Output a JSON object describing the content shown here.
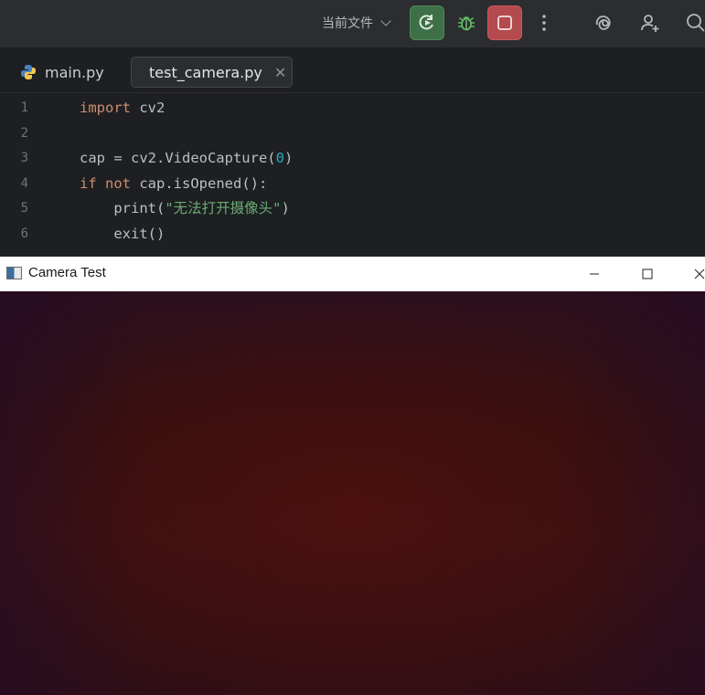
{
  "toolbar": {
    "run_config_label": "当前文件",
    "rerun_icon": "rerun-icon",
    "debug_icon": "bug-icon",
    "stop_icon": "stop-icon",
    "more_icon": "more-vertical-icon",
    "ai_icon": "ai-assistant-icon",
    "user_icon": "add-user-icon",
    "search_icon": "search-icon",
    "colors": {
      "rerun_bg": "#3d7046",
      "stop_bg": "#b34a4e",
      "debug_green": "#5fb865"
    }
  },
  "tabs": [
    {
      "label": "main.py",
      "icon": "python-icon",
      "active": false
    },
    {
      "label": "test_camera.py",
      "icon": "python-icon",
      "active": true,
      "closable": true
    }
  ],
  "code": {
    "lines": [
      {
        "n": "1",
        "tokens": [
          {
            "t": "import",
            "c": "kw"
          },
          {
            "t": " cv2",
            "c": ""
          }
        ]
      },
      {
        "n": "2",
        "tokens": []
      },
      {
        "n": "3",
        "tokens": [
          {
            "t": "cap = cv2.VideoCapture(",
            "c": ""
          },
          {
            "t": "0",
            "c": "num"
          },
          {
            "t": ")",
            "c": ""
          }
        ]
      },
      {
        "n": "4",
        "tokens": [
          {
            "t": "if",
            "c": "kw"
          },
          {
            "t": " ",
            "c": ""
          },
          {
            "t": "not",
            "c": "kw"
          },
          {
            "t": " cap.isOpened():",
            "c": ""
          }
        ]
      },
      {
        "n": "5",
        "tokens": [
          {
            "t": "    print(",
            "c": ""
          },
          {
            "t": "\"无法打开摄像头\"",
            "c": "str"
          },
          {
            "t": ")",
            "c": ""
          }
        ]
      },
      {
        "n": "6",
        "tokens": [
          {
            "t": "    exit()",
            "c": ""
          }
        ]
      }
    ]
  },
  "camera_window": {
    "title": "Camera Test",
    "app_icon": "opencv-window-icon",
    "minimize_icon": "minimize-icon",
    "maximize_icon": "maximize-icon",
    "close_icon": "close-icon"
  }
}
